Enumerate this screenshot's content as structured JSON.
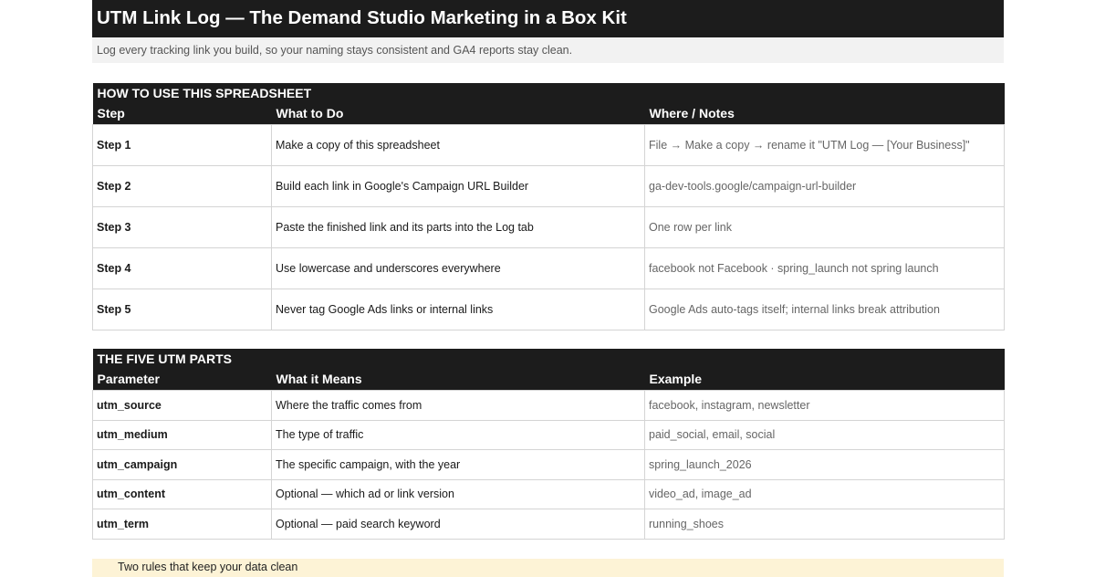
{
  "page": {
    "title": "UTM Link Log — The Demand Studio Marketing in a Box Kit",
    "subtitle": "Log every tracking link you build, so your naming stays consistent and GA4 reports stay clean."
  },
  "how_to": {
    "section_title": "HOW TO USE THIS SPREADSHEET",
    "headers": [
      "Step",
      "What to Do",
      "Where / Notes"
    ],
    "rows": [
      [
        "Step 1",
        "Make a copy of this spreadsheet",
        "File → Make a copy → rename it \"UTM Log — [Your Business]\""
      ],
      [
        "Step 2",
        "Build each link in Google's Campaign URL Builder",
        "ga-dev-tools.google/campaign-url-builder"
      ],
      [
        "Step 3",
        "Paste the finished link and its parts into the Log tab",
        "One row per link"
      ],
      [
        "Step 4",
        "Use lowercase and underscores everywhere",
        "facebook not Facebook · spring_launch not spring launch"
      ],
      [
        "Step 5",
        "Never tag Google Ads links or internal links",
        "Google Ads auto-tags itself; internal links break attribution"
      ]
    ]
  },
  "utm_parts": {
    "section_title": "THE FIVE UTM PARTS",
    "headers": [
      "Parameter",
      "What it Means",
      "Example"
    ],
    "rows": [
      [
        "utm_source",
        "Where the traffic comes from",
        "facebook, instagram, newsletter"
      ],
      [
        "utm_medium",
        "The type of traffic",
        "paid_social, email, social"
      ],
      [
        "utm_campaign",
        "The specific campaign, with the year",
        "spring_launch_2026"
      ],
      [
        "utm_content",
        "Optional — which ad or link version",
        "video_ad, image_ad"
      ],
      [
        "utm_term",
        "Optional — paid search keyword",
        "running_shoes"
      ]
    ]
  },
  "rules": {
    "label": "Two rules that keep your data clean"
  }
}
